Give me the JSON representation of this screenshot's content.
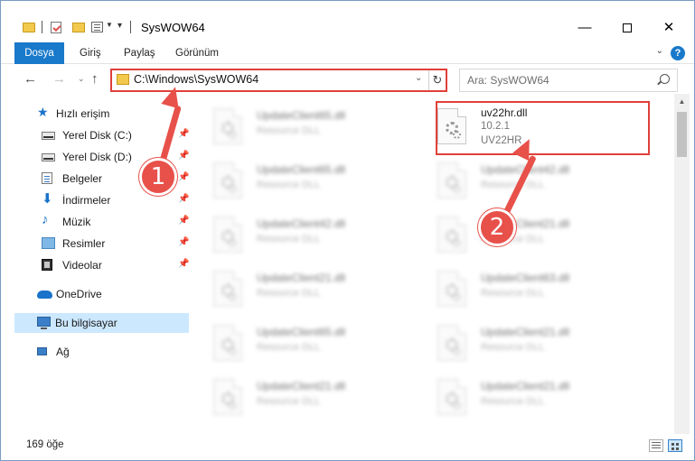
{
  "window": {
    "title": "SysWOW64",
    "minimize": "—",
    "close": "✕"
  },
  "ribbon": {
    "tabs": [
      "Dosya",
      "Giriş",
      "Paylaş",
      "Görünüm"
    ]
  },
  "address": {
    "path": "C:\\Windows\\SysWOW64",
    "search_placeholder": "Ara: SysWOW64"
  },
  "navpane": {
    "quick_access": "Hızlı erişim",
    "items": [
      {
        "label": "Yerel Disk (C:)",
        "icon": "drive-icon"
      },
      {
        "label": "Yerel Disk (D:)",
        "icon": "drive-icon"
      },
      {
        "label": "Belgeler",
        "icon": "documents-icon"
      },
      {
        "label": "İndirmeler",
        "icon": "downloads-icon"
      },
      {
        "label": "Müzik",
        "icon": "music-icon"
      },
      {
        "label": "Resimler",
        "icon": "pictures-icon"
      },
      {
        "label": "Videolar",
        "icon": "videos-icon"
      }
    ],
    "onedrive": "OneDrive",
    "this_pc": "Bu bilgisayar",
    "network": "Ağ"
  },
  "files": [
    {
      "name": "UpdateClient65.dll",
      "desc": "Resource DLL"
    },
    {
      "name": "uv22hr.dll",
      "version": "10.2.1",
      "product": "UV22HR",
      "highlighted": true
    },
    {
      "name": "UpdateClient65.dll",
      "desc": "Resource DLL"
    },
    {
      "name": "UpdateClient42.dll",
      "desc": "Resource DLL"
    },
    {
      "name": "UpdateClient42.dll",
      "desc": "Resource DLL"
    },
    {
      "name": "UpdateClient21.dll",
      "desc": "Resource DLL"
    },
    {
      "name": "UpdateClient21.dll",
      "desc": "Resource DLL"
    },
    {
      "name": "UpdateClient63.dll",
      "desc": "Resource DLL"
    },
    {
      "name": "UpdateClient65.dll",
      "desc": "Resource DLL"
    },
    {
      "name": "UpdateClient21.dll",
      "desc": "Resource DLL"
    },
    {
      "name": "UpdateClient21.dll",
      "desc": "Resource DLL"
    },
    {
      "name": "UpdateClient21.dll",
      "desc": "Resource DLL"
    }
  ],
  "status": {
    "item_count": "169 öğe"
  },
  "annotations": {
    "step1": "1",
    "step2": "2",
    "color": "#e8504a"
  }
}
